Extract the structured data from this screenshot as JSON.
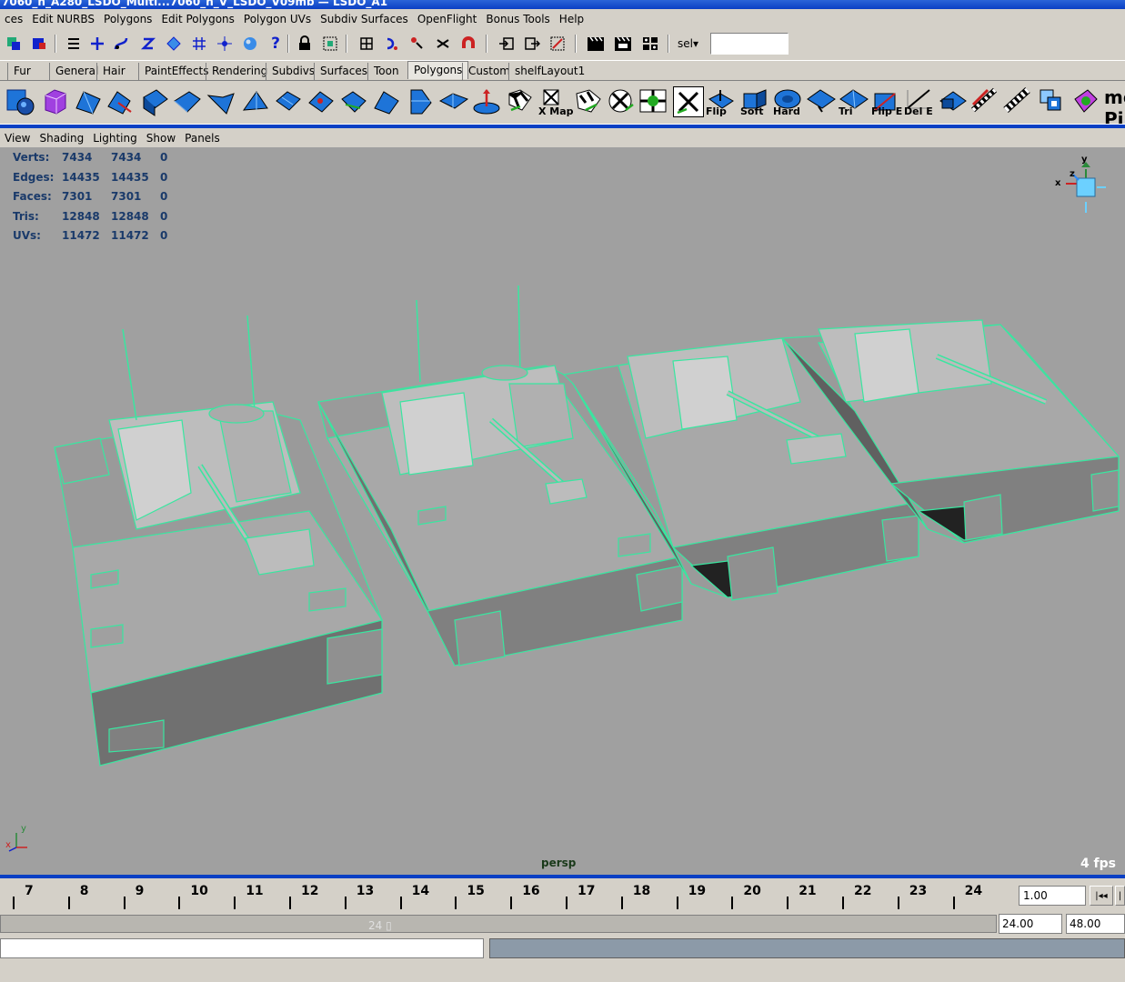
{
  "title": "7060_n_A280_LSDO_Multi...7060_n_V_LSDO_V09mb — LSDO_A1",
  "menubar": [
    "ces",
    "Edit NURBS",
    "Polygons",
    "Edit Polygons",
    "Polygon UVs",
    "Subdiv Surfaces",
    "OpenFlight",
    "Bonus Tools",
    "Help"
  ],
  "statusline": {
    "sel_label": "sel",
    "sel_value": ""
  },
  "shelf_tabs": [
    "Fur",
    "General",
    "Hair",
    "PaintEffects",
    "Rendering",
    "Subdivs",
    "Surfaces",
    "Toon",
    "Polygons",
    "Custom",
    "shelfLayout1"
  ],
  "active_shelf_tab": "Polygons",
  "shelf_labels": [
    "X Map",
    "Flip",
    "Soft",
    "Hard",
    "Tri",
    "Flip E",
    "Del E",
    "me Pip"
  ],
  "panel_menu": [
    "View",
    "Shading",
    "Lighting",
    "Show",
    "Panels"
  ],
  "stats": [
    {
      "label": "Verts:",
      "a": "7434",
      "b": "7434",
      "c": "0"
    },
    {
      "label": "Edges:",
      "a": "14435",
      "b": "14435",
      "c": "0"
    },
    {
      "label": "Faces:",
      "a": "7301",
      "b": "7301",
      "c": "0"
    },
    {
      "label": "Tris:",
      "a": "12848",
      "b": "12848",
      "c": "0"
    },
    {
      "label": "UVs:",
      "a": "11472",
      "b": "11472",
      "c": "0"
    }
  ],
  "viewport": {
    "camera": "persp",
    "fps": "4 fps",
    "axis_x": "x",
    "axis_y": "y",
    "axis_z": "z"
  },
  "timeline": {
    "ticks": [
      "7",
      "8",
      "9",
      "10",
      "11",
      "12",
      "13",
      "14",
      "15",
      "16",
      "17",
      "18",
      "19",
      "20",
      "21",
      "22",
      "23",
      "24"
    ],
    "current_frame": "1.00",
    "range_marker": "24",
    "range_start": "24.00",
    "range_end": "48.00"
  },
  "colors": {
    "wire": "#39e6a0",
    "viewport_bg": "#a0a0a0",
    "ui_bg": "#d4d0c8",
    "accent_blue": "#0a3fc4"
  }
}
